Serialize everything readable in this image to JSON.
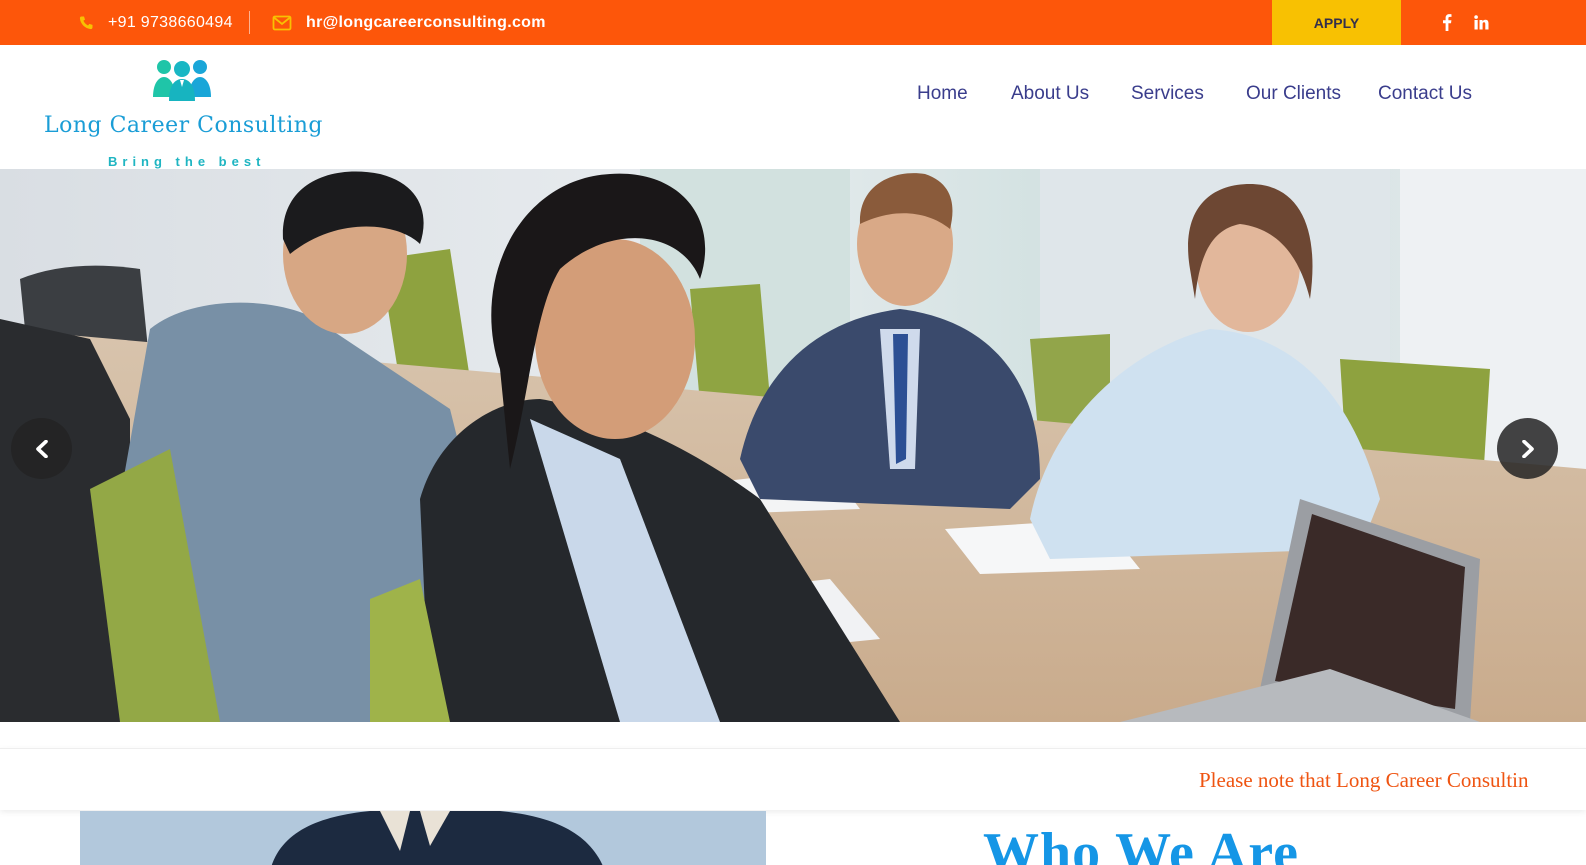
{
  "topbar": {
    "phone": "+91 9738660494",
    "email": "hr@longcareerconsulting.com",
    "apply_label": "APPLY",
    "social": [
      "facebook-icon",
      "linkedin-icon"
    ],
    "bg_color": "#fd560a",
    "apply_color": "#f8c102"
  },
  "header": {
    "logo_name": "Long Career  Consulting",
    "logo_tagline": "Bring the best",
    "nav": [
      "Home",
      "About Us",
      "Services",
      "Our Clients",
      "Contact Us"
    ],
    "nav_color": "#3a3d8c"
  },
  "hero": {
    "icons": [
      "chevron-left-icon",
      "chevron-right-icon"
    ]
  },
  "notice": {
    "text": "Please note that Long Career Consultin",
    "color": "#ef5411"
  },
  "about": {
    "title": "Who We Are",
    "title_color": "#1596e6"
  }
}
